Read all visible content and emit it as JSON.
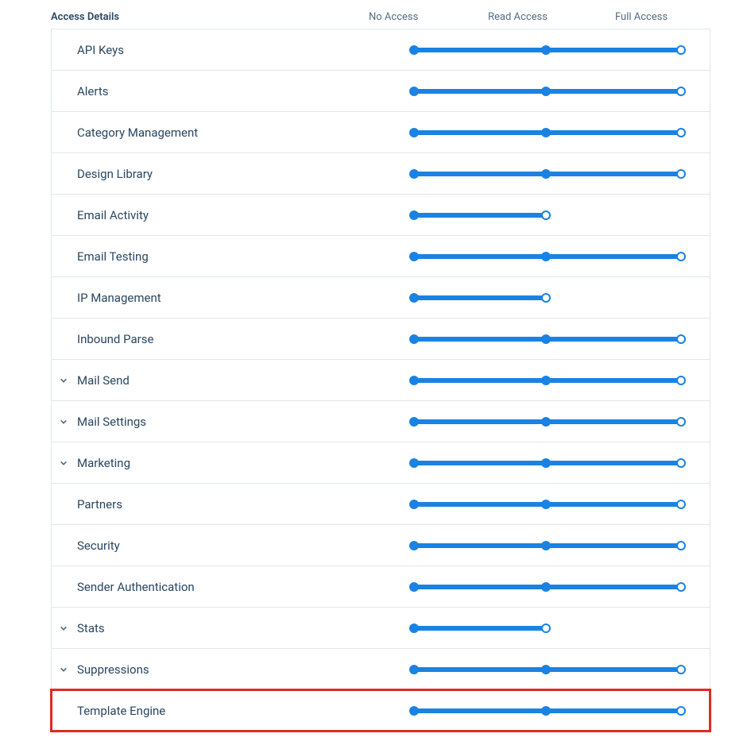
{
  "header": {
    "title": "Access Details",
    "col_noaccess": "No Access",
    "col_read": "Read Access",
    "col_full": "Full Access"
  },
  "colors": {
    "accent": "#1a82e2",
    "text": "#294661",
    "muted": "#546b81",
    "border": "#e1e6eb",
    "highlight": "#e02b20"
  },
  "slider_positions": {
    "noaccess": 0,
    "read": 166,
    "full": 336
  },
  "rows": [
    {
      "label": "API Keys",
      "expandable": false,
      "level": "full",
      "highlighted": false
    },
    {
      "label": "Alerts",
      "expandable": false,
      "level": "full",
      "highlighted": false
    },
    {
      "label": "Category Management",
      "expandable": false,
      "level": "full",
      "highlighted": false
    },
    {
      "label": "Design Library",
      "expandable": false,
      "level": "full",
      "highlighted": false
    },
    {
      "label": "Email Activity",
      "expandable": false,
      "level": "read",
      "highlighted": false
    },
    {
      "label": "Email Testing",
      "expandable": false,
      "level": "full",
      "highlighted": false
    },
    {
      "label": "IP Management",
      "expandable": false,
      "level": "read",
      "highlighted": false
    },
    {
      "label": "Inbound Parse",
      "expandable": false,
      "level": "full",
      "highlighted": false
    },
    {
      "label": "Mail Send",
      "expandable": true,
      "level": "full",
      "highlighted": false
    },
    {
      "label": "Mail Settings",
      "expandable": true,
      "level": "full",
      "highlighted": false
    },
    {
      "label": "Marketing",
      "expandable": true,
      "level": "full",
      "highlighted": false
    },
    {
      "label": "Partners",
      "expandable": false,
      "level": "full",
      "highlighted": false
    },
    {
      "label": "Security",
      "expandable": false,
      "level": "full",
      "highlighted": false
    },
    {
      "label": "Sender Authentication",
      "expandable": false,
      "level": "full",
      "highlighted": false
    },
    {
      "label": "Stats",
      "expandable": true,
      "level": "read",
      "highlighted": false
    },
    {
      "label": "Suppressions",
      "expandable": true,
      "level": "full",
      "highlighted": false
    },
    {
      "label": "Template Engine",
      "expandable": false,
      "level": "full",
      "highlighted": true
    }
  ]
}
